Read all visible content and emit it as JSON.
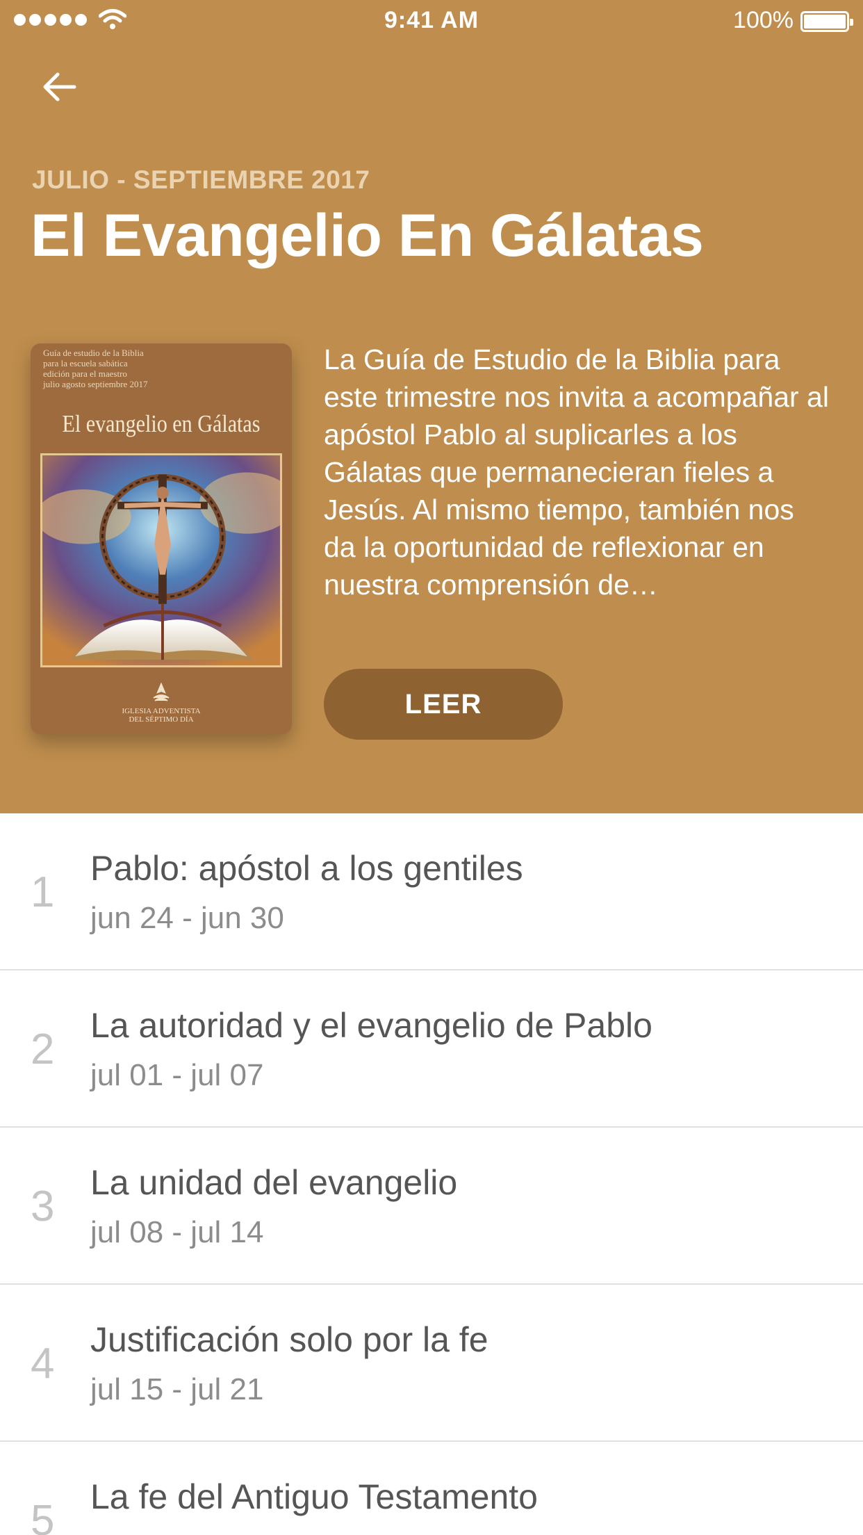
{
  "status_bar": {
    "time": "9:41 AM",
    "battery": "100%"
  },
  "header": {
    "quarter": "JULIO - SEPTIEMBRE 2017",
    "title": "El Evangelio En Gálatas",
    "description": "La Guía de Estudio de la Biblia para este trimestre nos invita a acompañar al apóstol Pablo al suplicarles a los Gálatas que permanecieran fieles a Jesús. Al mismo tiempo, también nos da la oportunidad de reflexionar en nuestra comprensión de…",
    "read_button": "LEER",
    "background_color": "#BF8E4E",
    "button_color": "#8F6232"
  },
  "cover": {
    "small_lines": [
      "Guía de estudio de la Biblia",
      "para la escuela sabática",
      "edición para el maestro",
      "julio agosto septiembre 2017"
    ],
    "title": "El evangelio en Gálatas",
    "logo_lines": [
      "IGLESIA ADVENTISTA",
      "DEL SÉPTIMO DÍA"
    ]
  },
  "lessons": [
    {
      "number": "1",
      "title": "Pablo: apóstol a los gentiles",
      "dates": "jun 24 - jun 30"
    },
    {
      "number": "2",
      "title": "La autoridad y el evangelio de Pablo",
      "dates": "jul 01 - jul 07"
    },
    {
      "number": "3",
      "title": "La unidad del evangelio",
      "dates": "jul 08 - jul 14"
    },
    {
      "number": "4",
      "title": "Justificación solo por la fe",
      "dates": "jul 15 - jul 21"
    },
    {
      "number": "5",
      "title": "La fe del Antiguo Testamento",
      "dates": ""
    }
  ]
}
